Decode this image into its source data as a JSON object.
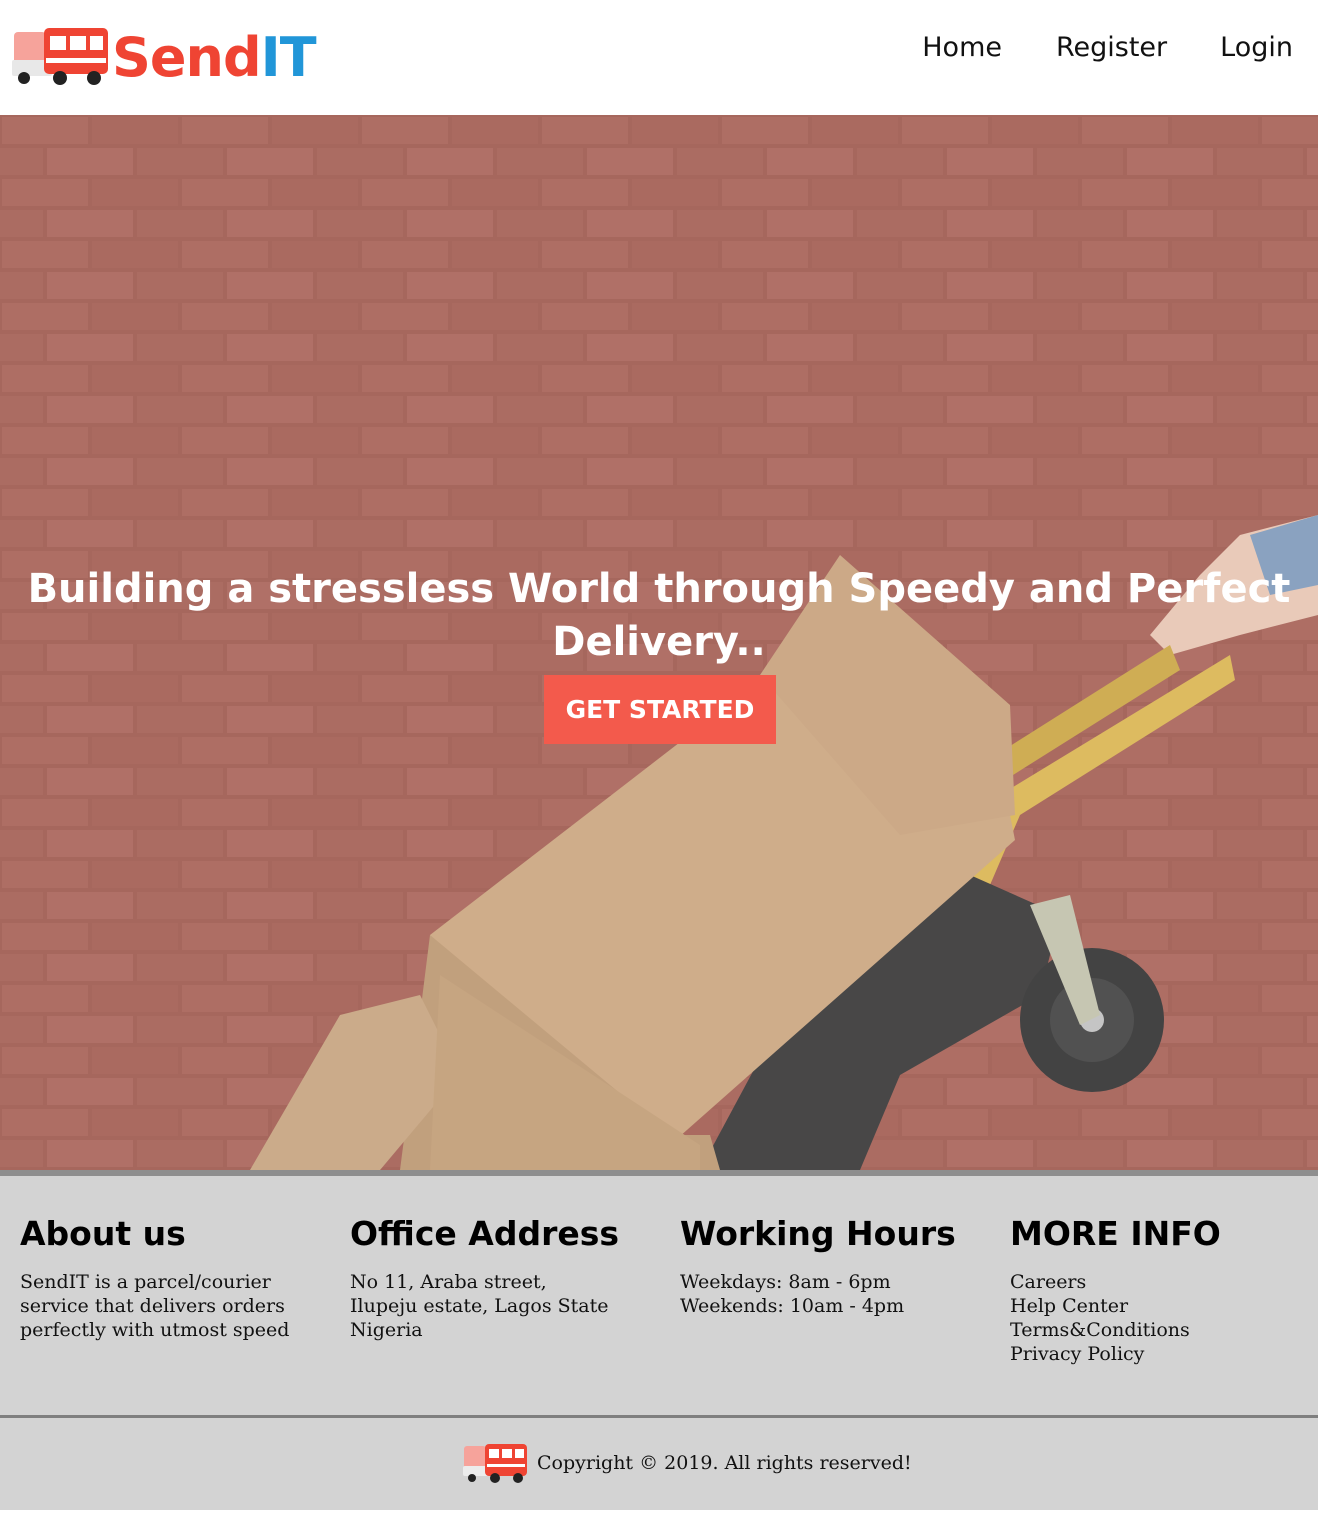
{
  "brand": {
    "name_part1": "Send",
    "name_part2": "IT",
    "send_color": "#ef4433",
    "it_color": "#2196d8"
  },
  "nav": {
    "home": "Home",
    "register": "Register",
    "login": "Login"
  },
  "hero": {
    "title": "Building a stressless World through Speedy and Perfect Delivery..",
    "cta_label": "GET STARTED",
    "cta_color": "#f35a4c"
  },
  "footer": {
    "about": {
      "heading": "About us",
      "text": "SendIT is a parcel/courier service that delivers orders perfectly with utmost speed"
    },
    "office": {
      "heading": "Office Address",
      "text": "No 11, Araba street, Ilupeju estate, Lagos State Nigeria"
    },
    "hours": {
      "heading": "Working Hours",
      "weekdays": "Weekdays: 8am - 6pm",
      "weekends": "Weekends: 10am - 4pm"
    },
    "more": {
      "heading": "MORE INFO",
      "links": [
        "Careers",
        "Help Center",
        "Terms&Conditions",
        "Privacy Policy"
      ]
    },
    "copyright": "Copyright © 2019. All rights reserved!"
  }
}
